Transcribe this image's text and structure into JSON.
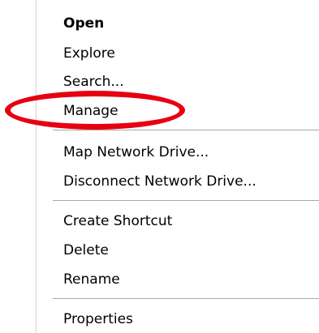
{
  "context_menu": {
    "items": [
      {
        "label": "Open",
        "bold": true
      },
      {
        "label": "Explore"
      },
      {
        "label": "Search..."
      },
      {
        "label": "Manage"
      },
      {
        "label": "Map Network Drive..."
      },
      {
        "label": "Disconnect Network Drive..."
      },
      {
        "label": "Create Shortcut"
      },
      {
        "label": "Delete"
      },
      {
        "label": "Rename"
      },
      {
        "label": "Properties"
      }
    ]
  },
  "annotation": {
    "highlight_color": "#e60012",
    "highlighted_item": "Manage"
  },
  "colors": {
    "menu_background": "#ffffff",
    "separator": "#aca899",
    "text": "#000000"
  }
}
